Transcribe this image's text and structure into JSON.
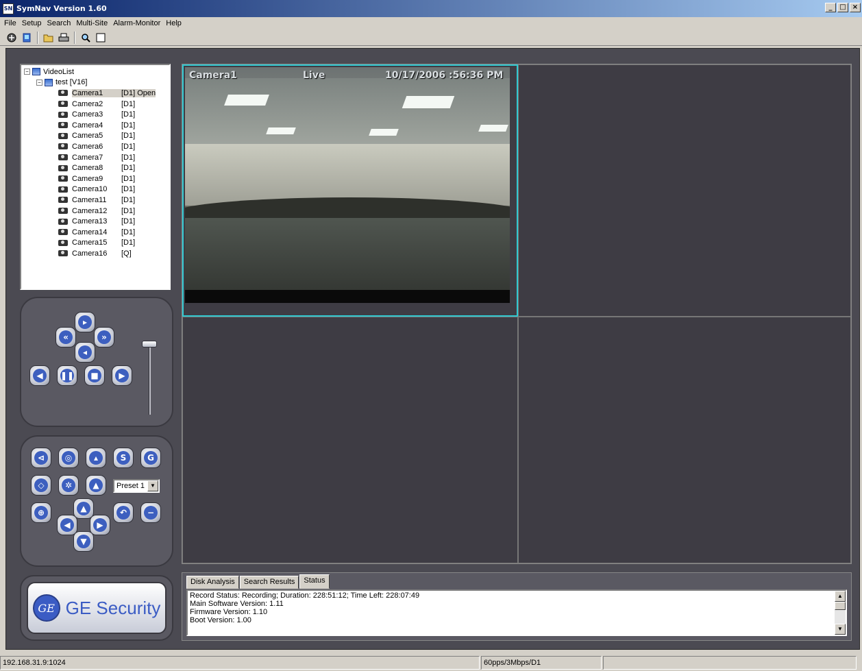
{
  "window": {
    "title": "SymNav Version 1.60",
    "controls": [
      "_",
      "□",
      "×"
    ]
  },
  "menu": [
    "File",
    "Setup",
    "Search",
    "Multi-Site",
    "Alarm-Monitor",
    "Help"
  ],
  "toolbar": {
    "icons": [
      "connect-icon",
      "videolist-icon",
      "open-folder-icon",
      "print-icon",
      "search-icon",
      "blank-window-icon"
    ]
  },
  "tree": {
    "root": "VideoList",
    "recorder": "test [V16]",
    "cameras": [
      {
        "name": "Camera1",
        "status": "[D1] Open"
      },
      {
        "name": "Camera2",
        "status": "[D1]"
      },
      {
        "name": "Camera3",
        "status": "[D1]"
      },
      {
        "name": "Camera4",
        "status": "[D1]"
      },
      {
        "name": "Camera5",
        "status": "[D1]"
      },
      {
        "name": "Camera6",
        "status": "[D1]"
      },
      {
        "name": "Camera7",
        "status": "[D1]"
      },
      {
        "name": "Camera8",
        "status": "[D1]"
      },
      {
        "name": "Camera9",
        "status": "[D1]"
      },
      {
        "name": "Camera10",
        "status": "[D1]"
      },
      {
        "name": "Camera11",
        "status": "[D1]"
      },
      {
        "name": "Camera12",
        "status": "[D1]"
      },
      {
        "name": "Camera13",
        "status": "[D1]"
      },
      {
        "name": "Camera14",
        "status": "[D1]"
      },
      {
        "name": "Camera15",
        "status": "[D1]"
      },
      {
        "name": "Camera16",
        "status": "[Q]"
      }
    ]
  },
  "ptz": {
    "preset": "Preset 1",
    "s_label": "S",
    "g_label": "G"
  },
  "logo": {
    "mark": "GE",
    "text": "GE Security"
  },
  "video": {
    "overlay_camera": "Camera1",
    "overlay_mode": "Live",
    "overlay_time": "10/17/2006 :56:36 PM"
  },
  "bottom": {
    "tabs": [
      "Disk Analysis",
      "Search Results",
      "Status"
    ],
    "status_lines": [
      "Record Status:  Recording;  Duration:  228:51:12;  Time Left:  228:07:49",
      "Main Software Version:  1.11",
      "Firmware Version:  1.10",
      "Boot Version:  1.00"
    ]
  },
  "statusbar": {
    "address": "192.168.31.9:1024",
    "rate": "60pps/3Mbps/D1",
    "extra": ""
  }
}
